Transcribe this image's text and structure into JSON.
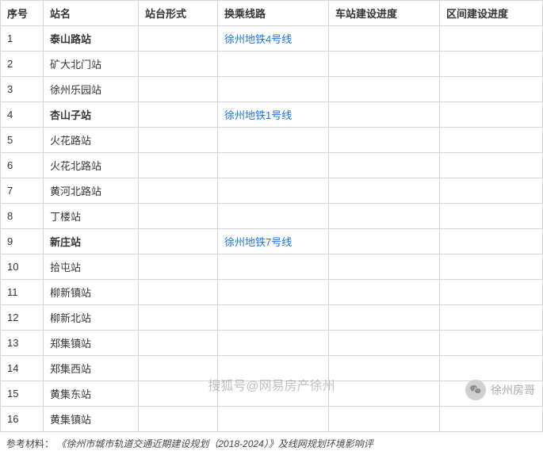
{
  "table": {
    "headers": {
      "num": "序号",
      "name": "站名",
      "platform": "站台形式",
      "transfer": "换乘线路",
      "station_progress": "车站建设进度",
      "section_progress": "区间建设进度"
    },
    "rows": [
      {
        "num": "1",
        "name": "泰山路站",
        "bold": true,
        "platform": "",
        "transfer": "徐州地铁4号线",
        "transfer_link": true,
        "station_progress": "",
        "section_progress": ""
      },
      {
        "num": "2",
        "name": "矿大北门站",
        "bold": false,
        "platform": "",
        "transfer": "",
        "transfer_link": false,
        "station_progress": "",
        "section_progress": ""
      },
      {
        "num": "3",
        "name": "徐州乐园站",
        "bold": false,
        "platform": "",
        "transfer": "",
        "transfer_link": false,
        "station_progress": "",
        "section_progress": ""
      },
      {
        "num": "4",
        "name": "杏山子站",
        "bold": true,
        "platform": "",
        "transfer": "徐州地铁1号线",
        "transfer_link": true,
        "station_progress": "",
        "section_progress": ""
      },
      {
        "num": "5",
        "name": "火花路站",
        "bold": false,
        "platform": "",
        "transfer": "",
        "transfer_link": false,
        "station_progress": "",
        "section_progress": ""
      },
      {
        "num": "6",
        "name": "火花北路站",
        "bold": false,
        "platform": "",
        "transfer": "",
        "transfer_link": false,
        "station_progress": "",
        "section_progress": ""
      },
      {
        "num": "7",
        "name": "黄河北路站",
        "bold": false,
        "platform": "",
        "transfer": "",
        "transfer_link": false,
        "station_progress": "",
        "section_progress": ""
      },
      {
        "num": "8",
        "name": "丁楼站",
        "bold": false,
        "platform": "",
        "transfer": "",
        "transfer_link": false,
        "station_progress": "",
        "section_progress": ""
      },
      {
        "num": "9",
        "name": "新庄站",
        "bold": true,
        "platform": "",
        "transfer": "徐州地铁7号线",
        "transfer_link": true,
        "station_progress": "",
        "section_progress": ""
      },
      {
        "num": "10",
        "name": "拾屯站",
        "bold": false,
        "platform": "",
        "transfer": "",
        "transfer_link": false,
        "station_progress": "",
        "section_progress": ""
      },
      {
        "num": "11",
        "name": "柳新镇站",
        "bold": false,
        "platform": "",
        "transfer": "",
        "transfer_link": false,
        "station_progress": "",
        "section_progress": ""
      },
      {
        "num": "12",
        "name": "柳新北站",
        "bold": false,
        "platform": "",
        "transfer": "",
        "transfer_link": false,
        "station_progress": "",
        "section_progress": ""
      },
      {
        "num": "13",
        "name": "郑集镇站",
        "bold": false,
        "platform": "",
        "transfer": "",
        "transfer_link": false,
        "station_progress": "",
        "section_progress": ""
      },
      {
        "num": "14",
        "name": "郑集西站",
        "bold": false,
        "platform": "",
        "transfer": "",
        "transfer_link": false,
        "station_progress": "",
        "section_progress": ""
      },
      {
        "num": "15",
        "name": "黄集东站",
        "bold": false,
        "platform": "",
        "transfer": "",
        "transfer_link": false,
        "station_progress": "",
        "section_progress": ""
      },
      {
        "num": "16",
        "name": "黄集镇站",
        "bold": false,
        "platform": "",
        "transfer": "",
        "transfer_link": false,
        "station_progress": "",
        "section_progress": ""
      }
    ]
  },
  "footnote": {
    "label": "参考材料：",
    "text": "《徐州市城市轨道交通近期建设规划（2018-2024）》及线网规划环境影响评"
  },
  "watermarks": {
    "center": "搜狐号@网易房产徐州",
    "right": "徐州房哥"
  }
}
